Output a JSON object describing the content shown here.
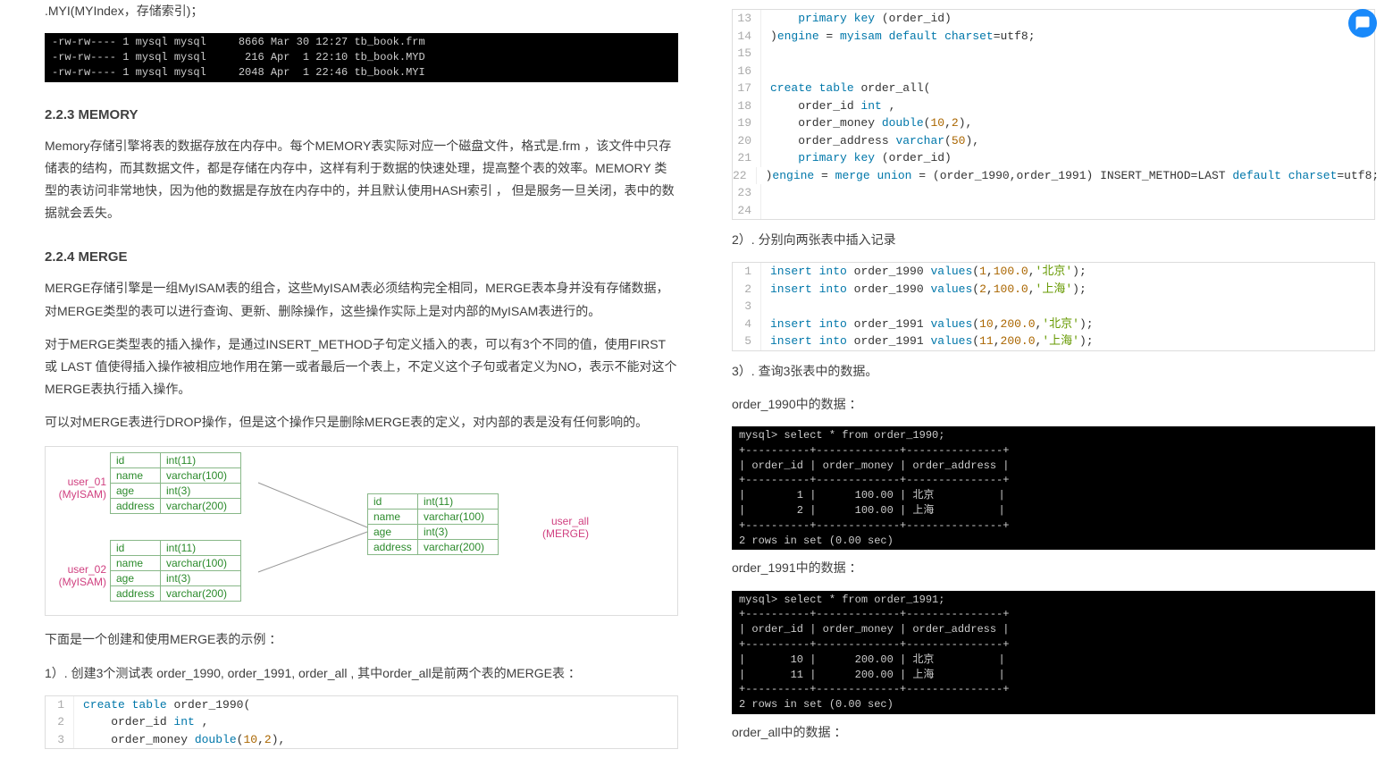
{
  "left": {
    "myi_line": ".MYI(MYIndex，存储索引)；",
    "term1": "-rw-rw---- 1 mysql mysql     8666 Mar 30 12:27 tb_book.frm\n-rw-rw---- 1 mysql mysql      216 Apr  1 22:10 tb_book.MYD\n-rw-rw---- 1 mysql mysql     2048 Apr  1 22:46 tb_book.MYI",
    "h_memory": "2.2.3 MEMORY",
    "p_memory": "Memory存储引擎将表的数据存放在内存中。每个MEMORY表实际对应一个磁盘文件，格式是.frm ，该文件中只存储表的结构，而其数据文件，都是存储在内存中，这样有利于数据的快速处理，提高整个表的效率。MEMORY 类型的表访问非常地快，因为他的数据是存放在内存中的，并且默认使用HASH索引 ， 但是服务一旦关闭，表中的数据就会丢失。",
    "h_merge": "2.2.4 MERGE",
    "p_merge1": "MERGE存储引擎是一组MyISAM表的组合，这些MyISAM表必须结构完全相同，MERGE表本身并没有存储数据，对MERGE类型的表可以进行查询、更新、删除操作，这些操作实际上是对内部的MyISAM表进行的。",
    "p_merge2": "对于MERGE类型表的插入操作，是通过INSERT_METHOD子句定义插入的表，可以有3个不同的值，使用FIRST 或 LAST 值使得插入操作被相应地作用在第一或者最后一个表上，不定义这个子句或者定义为NO，表示不能对这个MERGE表执行插入操作。",
    "p_merge3": "可以对MERGE表进行DROP操作，但是这个操作只是删除MERGE表的定义，对内部的表是没有任何影响的。",
    "diagram": {
      "user01": {
        "label": "user_01\n(MyISAM)",
        "rows": [
          [
            "id",
            "int(11)"
          ],
          [
            "name",
            "varchar(100)"
          ],
          [
            "age",
            "int(3)"
          ],
          [
            "address",
            "varchar(200)"
          ]
        ]
      },
      "user02": {
        "label": "user_02\n(MyISAM)",
        "rows": [
          [
            "id",
            "int(11)"
          ],
          [
            "name",
            "varchar(100)"
          ],
          [
            "age",
            "int(3)"
          ],
          [
            "address",
            "varchar(200)"
          ]
        ]
      },
      "userall": {
        "label": "user_all\n(MERGE)",
        "rows": [
          [
            "id",
            "int(11)"
          ],
          [
            "name",
            "varchar(100)"
          ],
          [
            "age",
            "int(3)"
          ],
          [
            "address",
            "varchar(200)"
          ]
        ]
      }
    },
    "p_example": "下面是一个创建和使用MERGE表的示例 ：",
    "p_step1": "1）. 创建3个测试表 order_1990, order_1991, order_all , 其中order_all是前两个表的MERGE表 ：",
    "code1": [
      [
        "1",
        "create table order_1990("
      ],
      [
        "2",
        "    order_id int ,"
      ],
      [
        "3",
        "    order_money double(10,2),"
      ]
    ]
  },
  "right": {
    "code_top": [
      [
        "13",
        "    primary key (order_id)"
      ],
      [
        "14",
        ")engine = myisam default charset=utf8;"
      ],
      [
        "15",
        ""
      ],
      [
        "16",
        ""
      ],
      [
        "17",
        "create table order_all("
      ],
      [
        "18",
        "    order_id int ,"
      ],
      [
        "19",
        "    order_money double(10,2),"
      ],
      [
        "20",
        "    order_address varchar(50),"
      ],
      [
        "21",
        "    primary key (order_id)"
      ],
      [
        "22",
        ")engine = merge union = (order_1990,order_1991) INSERT_METHOD=LAST default charset=utf8;"
      ],
      [
        "23",
        ""
      ],
      [
        "24",
        ""
      ]
    ],
    "p_step2": "2）. 分别向两张表中插入记录",
    "code_insert": [
      [
        "1",
        "insert into order_1990 values(1,100.0,'北京');"
      ],
      [
        "2",
        "insert into order_1990 values(2,100.0,'上海');"
      ],
      [
        "3",
        ""
      ],
      [
        "4",
        "insert into order_1991 values(10,200.0,'北京');"
      ],
      [
        "5",
        "insert into order_1991 values(11,200.0,'上海');"
      ]
    ],
    "p_step3": "3）. 查询3张表中的数据。",
    "p_1990": "order_1990中的数据 ：",
    "term1990": "mysql> select * from order_1990;\n+----------+-------------+---------------+\n| order_id | order_money | order_address |\n+----------+-------------+---------------+\n|        1 |      100.00 | 北京          |\n|        2 |      100.00 | 上海          |\n+----------+-------------+---------------+\n2 rows in set (0.00 sec)",
    "p_1991": "order_1991中的数据 ：",
    "term1991": "mysql> select * from order_1991;\n+----------+-------------+---------------+\n| order_id | order_money | order_address |\n+----------+-------------+---------------+\n|       10 |      200.00 | 北京          |\n|       11 |      200.00 | 上海          |\n+----------+-------------+---------------+\n2 rows in set (0.00 sec)",
    "p_all": "order_all中的数据 ："
  },
  "chart_data": {
    "type": "table",
    "tables": [
      {
        "name": "order_1990",
        "columns": [
          "order_id",
          "order_money",
          "order_address"
        ],
        "rows": [
          [
            1,
            100.0,
            "北京"
          ],
          [
            2,
            100.0,
            "上海"
          ]
        ]
      },
      {
        "name": "order_1991",
        "columns": [
          "order_id",
          "order_money",
          "order_address"
        ],
        "rows": [
          [
            10,
            200.0,
            "北京"
          ],
          [
            11,
            200.0,
            "上海"
          ]
        ]
      }
    ]
  }
}
